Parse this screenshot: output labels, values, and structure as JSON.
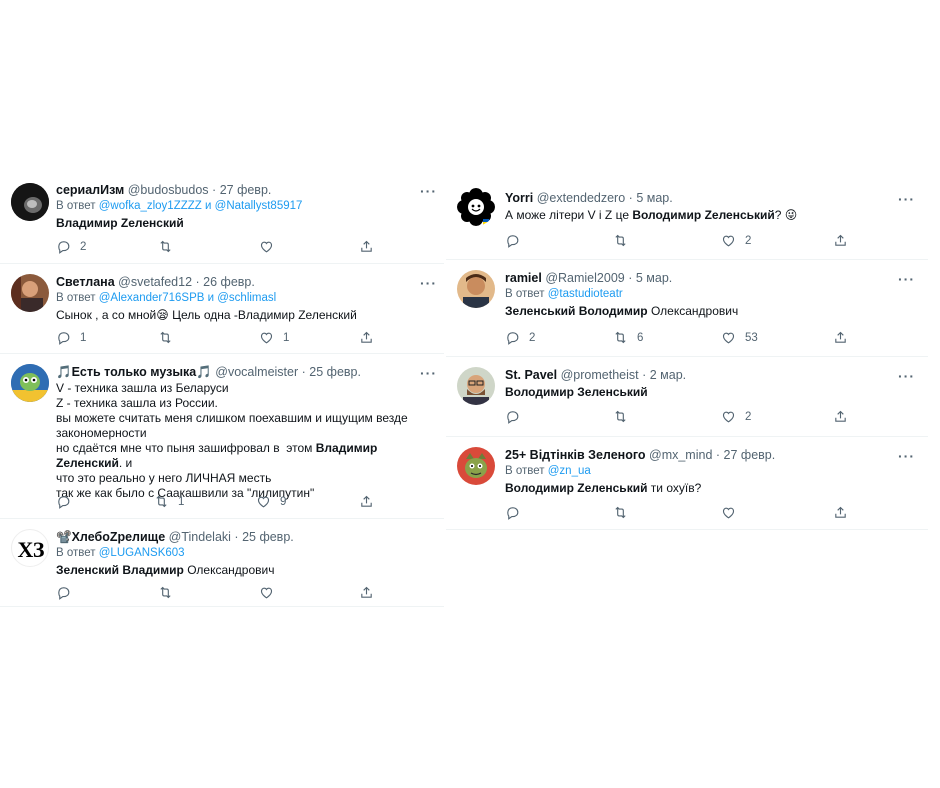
{
  "left": [
    {
      "name": "сериалИзм",
      "handle": "@budosbudos",
      "date": "27 февр.",
      "reply_prefix": "В ответ",
      "reply_links": [
        "@wofka_zloy1ZZZZ",
        "@Natallyst85917"
      ],
      "reply_joiner": "и",
      "body_bold": "Владимир Zеленский",
      "counts": {
        "reply": "2",
        "retweet": "",
        "like": ""
      },
      "avatar": "avatar-dark"
    },
    {
      "name": "Светлана",
      "handle": "@svetafed12",
      "date": "26 февр.",
      "reply_prefix": "В ответ",
      "reply_links": [
        "@Alexander716SPB",
        "@schlimasl"
      ],
      "reply_joiner": "и",
      "body_text_1": "Сынок , а со мной",
      "body_emoji": "😪",
      "body_text_2": " Цель одна -Владимир Zеленский",
      "counts": {
        "reply": "1",
        "retweet": "",
        "like": "1"
      },
      "avatar": "avatar-photo-woman"
    },
    {
      "name_prefix": "🎵",
      "name": "Есть только музыка",
      "name_suffix": "🎵",
      "handle": "@vocalmeister",
      "date": "25 февр.",
      "lines": [
        "V - техника зашла из Беларуси",
        "Z - техника зашла из России.",
        "вы можете считать меня слишком поехавшим и ищущим везде",
        "закономерности"
      ],
      "line5_a": "но сдаётся мне что пыня зашифровал в  этом ",
      "line5_bold": "Владимир Zеленский",
      "line5_b": ". и",
      "line6": "что это реально у него ЛИЧНАЯ месть",
      "line7": "так же как было с Саакашвили за \"лилипутин\"",
      "counts": {
        "reply": "",
        "retweet": "1",
        "like": "9"
      },
      "avatar": "avatar-cartoon"
    },
    {
      "name_prefix": "📽️",
      "name": "ХлебоZрелище",
      "handle": "@Tindelaki",
      "date": "25 февр.",
      "reply_prefix": "В ответ",
      "reply_links": [
        "@LUGANSK603"
      ],
      "body_bold": "Зеленский Владимир",
      "body_rest": " Олександрович",
      "counts": {
        "reply": "",
        "retweet": "",
        "like": ""
      },
      "avatar_text": "ХЗ"
    }
  ],
  "right": [
    {
      "name": "Yorri",
      "handle": "@extendedzero",
      "date": "5 мар.",
      "body_text": "А може літери V і Z це ",
      "body_bold": "Володимир Zеленський",
      "body_end": "? 😜",
      "counts": {
        "reply": "",
        "retweet": "",
        "like": "2"
      },
      "avatar": "avatar-flower"
    },
    {
      "name": "ramiel",
      "handle": "@Ramiel2009",
      "date": "5 мар.",
      "reply_prefix": "В ответ",
      "reply_links": [
        "@tastudioteatr"
      ],
      "body_bold": "Зеленський Володимир",
      "body_rest": " Олександрович",
      "counts": {
        "reply": "2",
        "retweet": "6",
        "like": "53"
      },
      "avatar": "avatar-photo-man"
    },
    {
      "name": "St. Pavel",
      "handle": "@prometheist",
      "date": "2 мар.",
      "body_bold": "Володимир Зеленський",
      "counts": {
        "reply": "",
        "retweet": "",
        "like": "2"
      },
      "avatar": "avatar-photo-glasses"
    },
    {
      "name": "25+ Відтінків Зеленого",
      "handle": "@mx_mind",
      "date": "27 февр.",
      "reply_prefix": "В ответ",
      "reply_links": [
        "@zn_ua"
      ],
      "body_bold": "Володимир Zеленський",
      "body_rest": " ти охуїв?",
      "counts": {
        "reply": "",
        "retweet": "",
        "like": ""
      },
      "avatar": "avatar-cat"
    }
  ],
  "ui": {
    "more": "···",
    "dot": "·",
    "colors": {
      "text": "#0f1419",
      "muted": "#536471",
      "link": "#1d9bf0",
      "divider": "#eff3f4"
    }
  }
}
